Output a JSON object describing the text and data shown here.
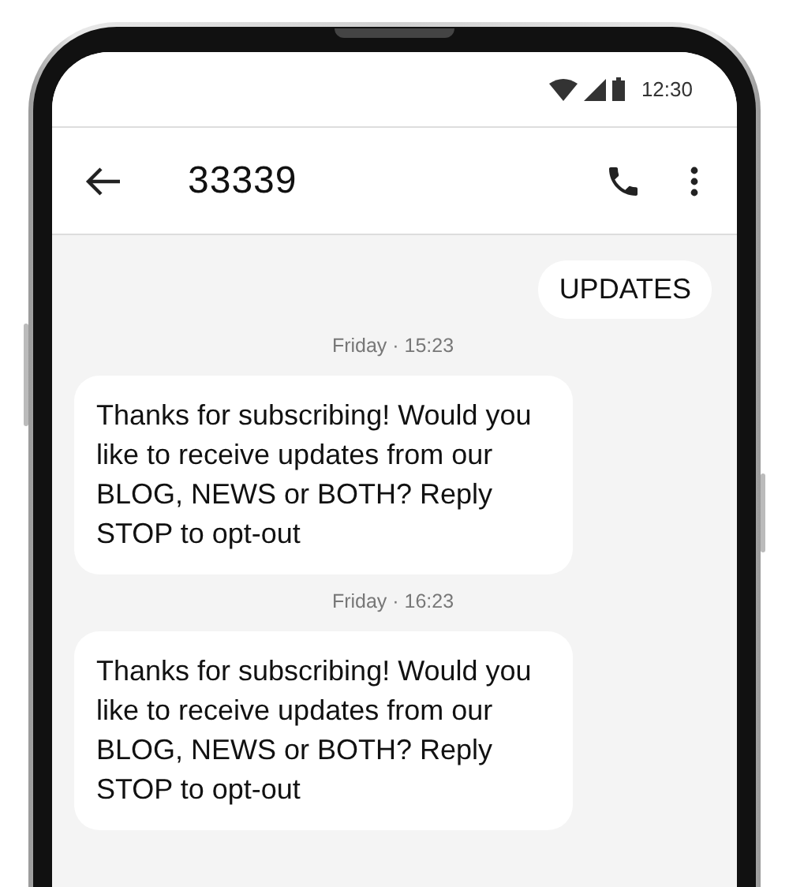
{
  "status_bar": {
    "time": "12:30"
  },
  "header": {
    "title": "33339"
  },
  "messages": [
    {
      "kind": "outgoing",
      "text": "UPDATES"
    },
    {
      "kind": "timestamp",
      "text": "Friday · 15:23"
    },
    {
      "kind": "incoming",
      "text": "Thanks for subscribing! Would you like to receive updates from our BLOG, NEWS or BOTH? Reply STOP to opt-out"
    },
    {
      "kind": "timestamp",
      "text": "Friday · 16:23"
    },
    {
      "kind": "incoming",
      "text": "Thanks for subscribing! Would you like to receive updates from our BLOG, NEWS or BOTH? Reply STOP to opt-out"
    }
  ]
}
